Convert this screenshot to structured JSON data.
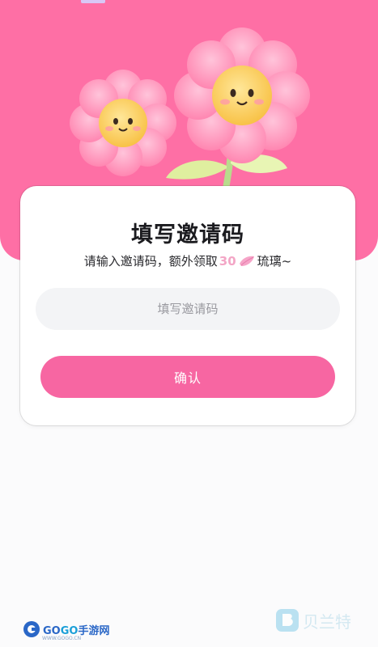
{
  "card": {
    "title": "填写邀请码",
    "subtitle_prefix": "请输入邀请码，额外领取",
    "reward_amount": "30",
    "reward_icon": "petal-icon",
    "subtitle_suffix": "琉璃~"
  },
  "invite_input": {
    "placeholder": "填写邀请码",
    "value": ""
  },
  "confirm_button": {
    "label": "确认"
  },
  "watermarks": {
    "left_brand_a": "GO",
    "left_brand_b": "GO",
    "left_brand_c": "手游网",
    "left_sub": "WWW.GOGO.CN",
    "right_brand": "贝兰特"
  },
  "colors": {
    "header": "#fe6fa5",
    "button": "#f766a2",
    "reward_amount": "#f3a6c6",
    "input_bg": "#f3f4f6"
  },
  "icons": {
    "illustration": "smiling-flowers-illustration"
  }
}
